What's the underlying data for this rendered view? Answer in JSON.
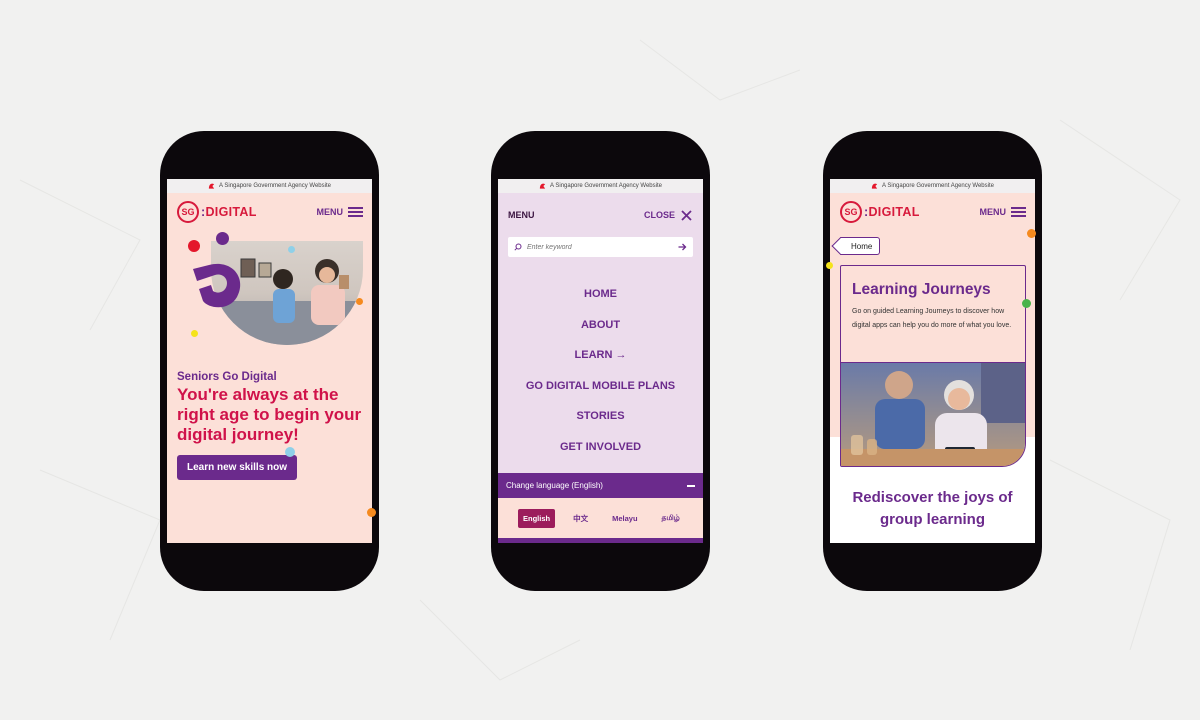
{
  "gov_banner": "A Singapore Government Agency Website",
  "brand": {
    "circle": "SG",
    "colon": ":",
    "word": "DIGITAL"
  },
  "colors": {
    "purple": "#6b2a8c",
    "red": "#d71a3c",
    "peach": "#fce0d8",
    "lilac": "#ecdcec"
  },
  "phone1": {
    "menu_label": "MENU",
    "kicker": "Seniors Go Digital",
    "headline": "You're always at the right age to begin your digital journey!",
    "cta": "Learn new skills now"
  },
  "phone2": {
    "menu_label": "MENU",
    "close_label": "CLOSE",
    "search_placeholder": "Enter keyword",
    "nav": [
      "HOME",
      "ABOUT",
      "LEARN →",
      "GO DIGITAL MOBILE PLANS",
      "STORIES",
      "GET INVOLVED"
    ],
    "language_bar": "Change language (English)",
    "languages": [
      "English",
      "中文",
      "Melayu",
      "தமிழ்"
    ]
  },
  "phone3": {
    "menu_label": "MENU",
    "breadcrumb": "Home",
    "card_title": "Learning Journeys",
    "card_desc": "Go on guided Learning Journeys to discover how digital apps can help you do more of what you love.",
    "section_title": "Rediscover the joys of group learning"
  }
}
